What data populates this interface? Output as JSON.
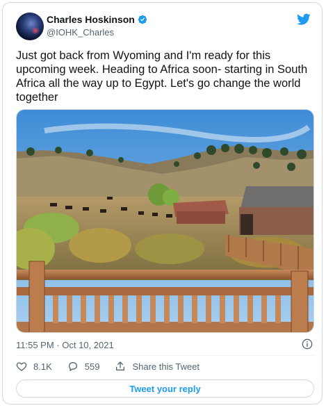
{
  "author": {
    "name": "Charles Hoskinson",
    "handle": "@IOHK_Charles"
  },
  "tweet": {
    "text": "Just got back from Wyoming and I'm ready for this upcoming week. Heading to Africa soon- starting in South Africa all the way up to Egypt. Let's go change the world together",
    "timestamp": "11:55 PM · Oct 10, 2021"
  },
  "actions": {
    "likes": "8.1K",
    "replies": "559",
    "share_label": "Share this Tweet"
  },
  "reply_button": {
    "label": "Tweet your reply"
  },
  "colors": {
    "accent": "#1d9bf0",
    "text": "#0f1419",
    "muted": "#536471",
    "border": "#cfd9de"
  },
  "icons": [
    "verified-badge-icon",
    "twitter-bird-icon",
    "info-icon",
    "heart-icon",
    "reply-icon",
    "share-icon"
  ]
}
